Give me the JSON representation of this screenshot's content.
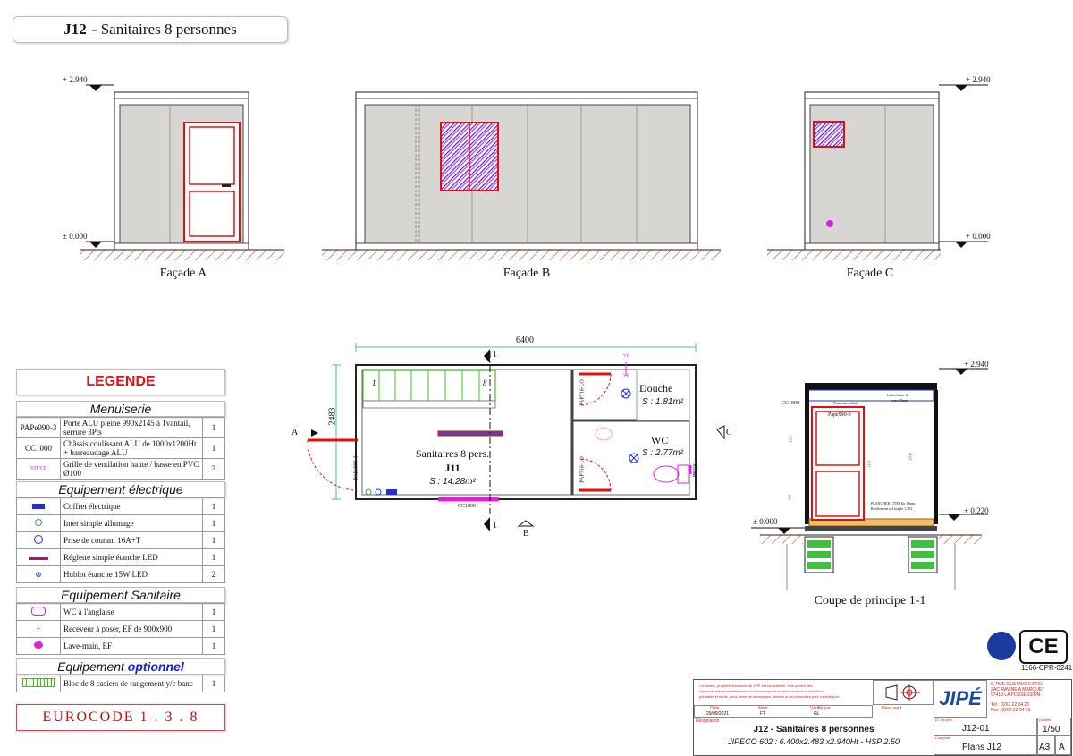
{
  "header": {
    "code": "J12",
    "title": "- Sanitaires 8 personnes"
  },
  "facades": {
    "a": {
      "caption": "Façade A",
      "level_top": "+ 2.940",
      "level_bottom": "± 0.000"
    },
    "b": {
      "caption": "Façade B"
    },
    "c": {
      "caption": "Façade C",
      "level_top": "+ 2.940",
      "level_bottom": "+ 0.000"
    }
  },
  "plan": {
    "width_dim": "6400",
    "height_dim": "2483",
    "section_mark": "1",
    "view_a": "A",
    "view_b": "B",
    "view_c": "C",
    "locker_first": "1",
    "locker_last": "8",
    "room_main": "Sanitaires 8 pers.",
    "room_main_code": "J11",
    "room_main_area": "S : 14.28m²",
    "room_shower": "Douche",
    "room_shower_area": "S : 1.81m²",
    "room_wc": "WC",
    "room_wc_area": "S : 2.77m²",
    "window_label": "CC1000",
    "door_main": "PAPe990-3",
    "door_inner1": "PAP716-LO",
    "door_inner2": "PAP716-LO",
    "vent_label1": "VH",
    "vent_label2": "VB",
    "vent_right": "PB500"
  },
  "section": {
    "caption": "Coupe de principe 1-1",
    "level_top": "+ 2.940",
    "level_mid": "+ 0.220",
    "level_bottom": "± 0.000",
    "label_window": "CC1000",
    "label_door": "Pape990-3",
    "label_ceiling": "Panneaux isolant",
    "label_wall1": "Isolant laine de",
    "label_wall2": "verre 80mm",
    "label_floor1": "PLANCHER CTBX Ep 18mm",
    "label_floor2": "Revêtement sol souple 1.5P2",
    "dim1": "1030",
    "dim2": "2145",
    "dim3": "2500",
    "dim4": "945"
  },
  "legend": {
    "title": "LEGENDE",
    "sections": [
      {
        "title": "Menuiserie",
        "rows": [
          {
            "code": "PAPe990-3",
            "desc": "Porte ALU pleine 990x2145 à 1vantail, serrure 3Pts",
            "qty": "1"
          },
          {
            "code": "CC1000",
            "desc": "Châssis coulissant ALU de 1000x1200Ht + barreaudage ALU",
            "qty": "1"
          },
          {
            "code": "VH VB",
            "desc": "Grille de ventilation haute / basse en PVC Ø100",
            "qty": "3"
          }
        ]
      },
      {
        "title": "Equipement électrique",
        "rows": [
          {
            "code": "",
            "desc": "Coffret électrique",
            "qty": "1"
          },
          {
            "code": "",
            "desc": "Inter simple allumage",
            "qty": "1"
          },
          {
            "code": "",
            "desc": "Prise de courant 16A+T",
            "qty": "1"
          },
          {
            "code": "",
            "desc": "Réglette simple étanche LED",
            "qty": "1"
          },
          {
            "code": "",
            "desc": "Hublot étanche 15W LED",
            "qty": "2"
          }
        ]
      },
      {
        "title": "Equipement Sanitaire",
        "rows": [
          {
            "code": "",
            "desc": "WC à l'anglaise",
            "qty": "1"
          },
          {
            "code": "",
            "desc": "Receveur à poser, EF de 900x900",
            "qty": "1"
          },
          {
            "code": "",
            "desc": "Lave-main, EF",
            "qty": "1"
          }
        ]
      }
    ],
    "optional_title_a": "Equipement",
    "optional_title_b": "optionnel",
    "optional_row": {
      "desc": "Bloc de 8 casiers de rangement y/c banc",
      "qty": "1"
    }
  },
  "eurocode": "EUROCODE 1 . 3 . 8",
  "ce": {
    "mark": "CE",
    "cert": "1166-CPR-0241"
  },
  "cartouche": {
    "notice1": "Ce dessin, propriété exclusive de JIPE est confidentiel. Il ne pourra être",
    "notice2": "reproduit, même partiellement, ni communiqué à un tiers sous son autorisation",
    "notice3": "préalable et écrite, sous peine de dommages, intérêts et de poursuites pour contrefaçon",
    "date_label": "Date",
    "nom_label": "Nom",
    "verif_label": "Vérifié par",
    "dessin_label": "Dess.verif",
    "date_value": "29/09/2021",
    "nom_value": "FT",
    "verif_value": "GL",
    "designation_label": "Désignation",
    "title_line1": "J12 - Sanitaires 8 personnes",
    "title_line2": "JIPECO 602 : 6.400x2.483 x2.940Ht - HSP 2.50",
    "brand": "JIPÉ",
    "address1": "6, RUE GUSTAVE EIFFEL",
    "address2": "ZAC RAVINE A MARQUET",
    "address3": "97419 LA POSSESSION",
    "tel": "Tél : 0262 22 04 20",
    "fax": "Fax : 0262 22 04 26",
    "num_plan_label": "N° de plan",
    "num_plan": "J12-01",
    "echelle_label": "Echelle",
    "echelle": "1/50",
    "compris_label": "Comprise",
    "plans": "Plans J12",
    "format": "A3",
    "indice": "A"
  },
  "colors": {
    "red": "#e01010",
    "magenta": "#e020e0",
    "green": "#40c020",
    "blue": "#1020d0",
    "wall": "#d8d6d3",
    "ground": "#b05020"
  }
}
